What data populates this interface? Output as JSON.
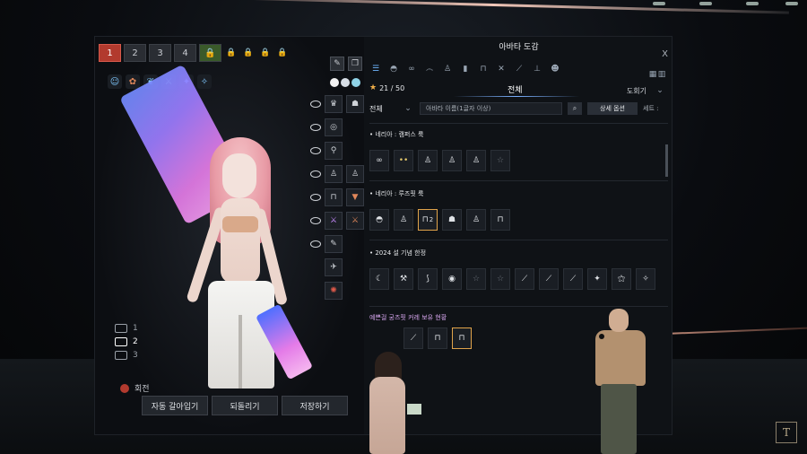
{
  "screen": {
    "preset_slots": [
      "1",
      "2",
      "3",
      "4"
    ],
    "camera": {
      "items": [
        {
          "label": "1"
        },
        {
          "label": "2"
        },
        {
          "label": "3"
        }
      ],
      "rotate_label": "회전"
    },
    "bottom_buttons": {
      "auto": "자동 갈아입기",
      "revert": "되돌리기",
      "save": "저장하기"
    }
  },
  "codex": {
    "title": "아바타 도감",
    "close": "X",
    "count": "21 / 50",
    "tab_all": "전체",
    "right_label": "도회기",
    "filter": {
      "scope": "전체",
      "name_placeholder": "아바타 이름(1글자 이상)",
      "detail_button": "상세 옵션",
      "set_label": "세트 :"
    },
    "sections": [
      {
        "title": "• 네리아 : 캠퍼스 룩"
      },
      {
        "title": "• 네리아 : 루즈핏 룩"
      },
      {
        "title": "• 2024 설 기념 한정"
      },
      {
        "title": "예쁜걸 궁즈핏 커레 보유 현황"
      }
    ],
    "selected_item_badge": "2"
  },
  "presenter_logo": "T"
}
